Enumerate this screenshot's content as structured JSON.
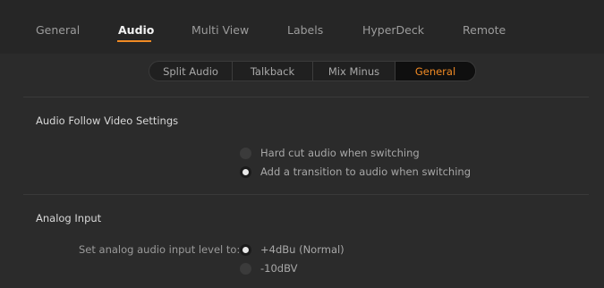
{
  "tabs": [
    {
      "label": "General",
      "active": false
    },
    {
      "label": "Audio",
      "active": true
    },
    {
      "label": "Multi View",
      "active": false
    },
    {
      "label": "Labels",
      "active": false
    },
    {
      "label": "HyperDeck",
      "active": false
    },
    {
      "label": "Remote",
      "active": false
    }
  ],
  "subtabs": [
    {
      "label": "Split Audio",
      "active": false
    },
    {
      "label": "Talkback",
      "active": false
    },
    {
      "label": "Mix Minus",
      "active": false
    },
    {
      "label": "General",
      "active": true
    }
  ],
  "audio_follow_video": {
    "title": "Audio Follow Video Settings",
    "options": [
      {
        "label": "Hard cut audio when switching",
        "selected": false
      },
      {
        "label": "Add a transition to audio when switching",
        "selected": true
      }
    ]
  },
  "analog_input": {
    "title": "Analog Input",
    "field_label": "Set analog audio input level to:",
    "options": [
      {
        "label": "+4dBu (Normal)",
        "selected": true
      },
      {
        "label": "-10dBV",
        "selected": false
      }
    ]
  },
  "colors": {
    "accent": "#f08a24",
    "background": "#2b2b2b",
    "header": "#262626"
  }
}
